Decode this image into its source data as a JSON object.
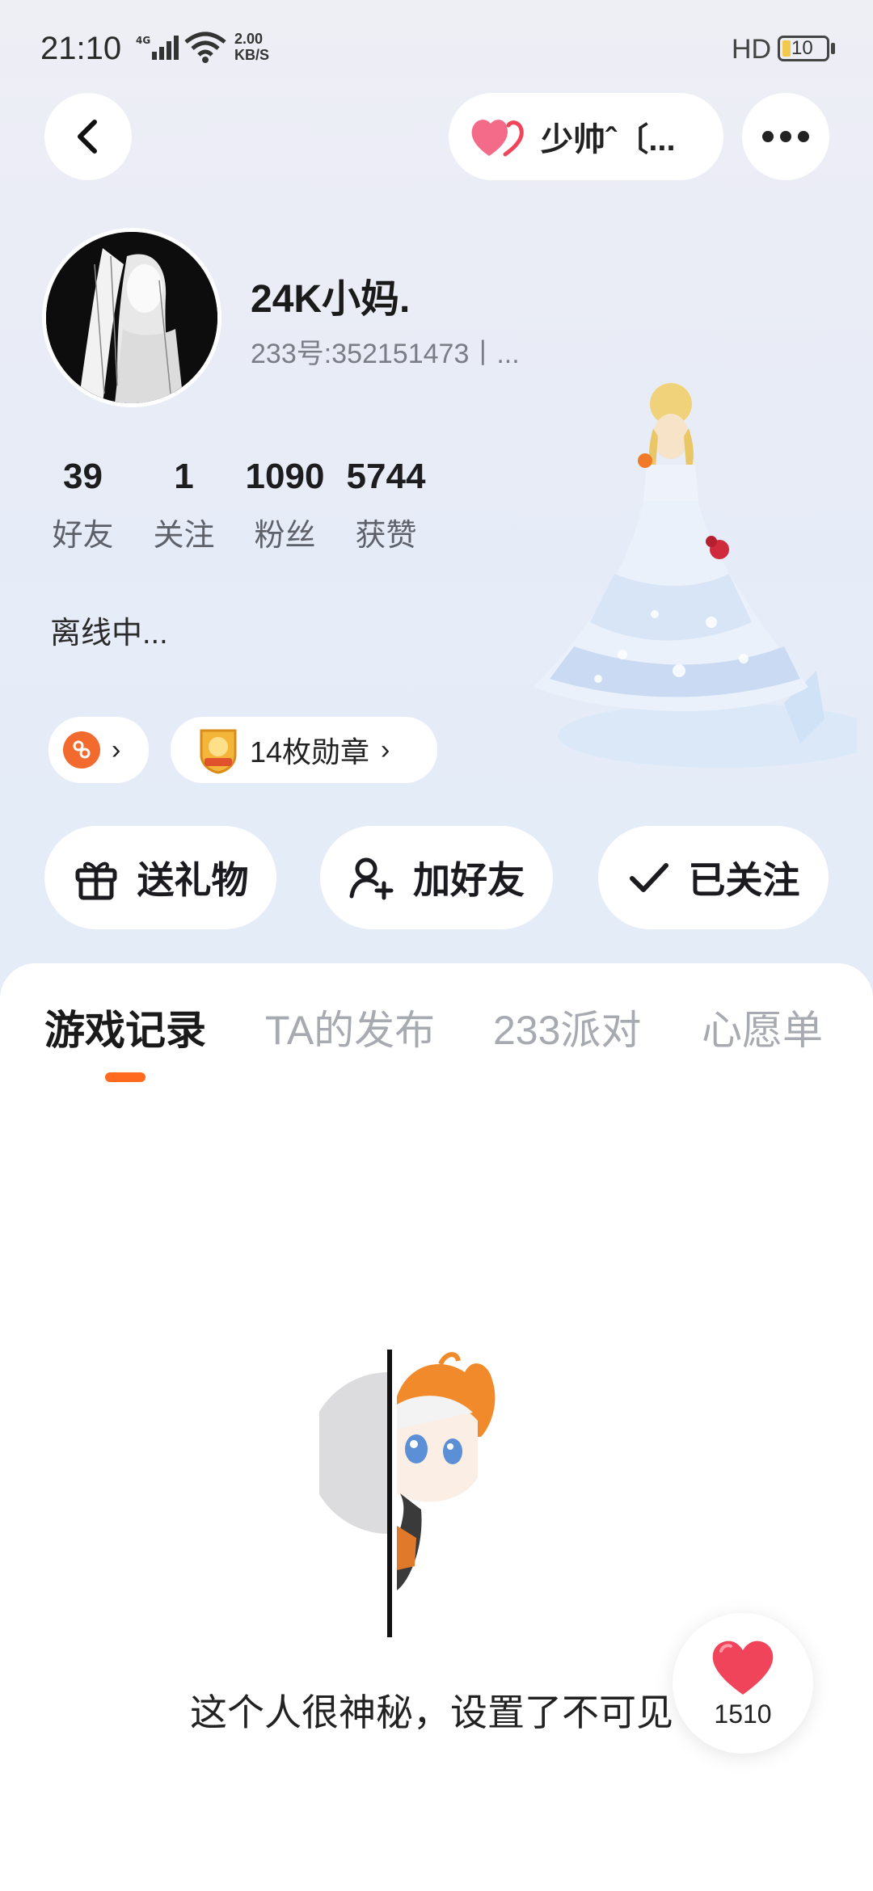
{
  "status_bar": {
    "time": "21:10",
    "network": "4G",
    "speed_value": "2.00",
    "speed_unit": "KB/S",
    "hd": "HD",
    "battery": "10"
  },
  "header": {
    "couple_name": "少帅ˆ〔..."
  },
  "profile": {
    "username": "24K小妈.",
    "user_id": "233号:352151473丨...",
    "stats": [
      {
        "value": "39",
        "label": "好友"
      },
      {
        "value": "1",
        "label": "关注"
      },
      {
        "value": "1090",
        "label": "粉丝"
      },
      {
        "value": "5744",
        "label": "获赞"
      }
    ],
    "status": "离线中...",
    "medal_label": "14枚勋章"
  },
  "actions": {
    "gift": "送礼物",
    "add_friend": "加好友",
    "followed": "已关注"
  },
  "tabs": [
    "游戏记录",
    "TA的发布",
    "233派对",
    "心愿单"
  ],
  "empty": {
    "text": "这个人很神秘，设置了不可见"
  },
  "like": {
    "count": "1510"
  },
  "colors": {
    "accent_orange": "#ff6a1f",
    "heart_red": "#f0445a",
    "heart_pink": "#f46b8a"
  },
  "icons": [
    "back-icon",
    "heart-icon",
    "more-icon",
    "group-icon",
    "chevron-right-icon",
    "medal-icon",
    "gift-icon",
    "add-friend-icon",
    "check-icon"
  ]
}
